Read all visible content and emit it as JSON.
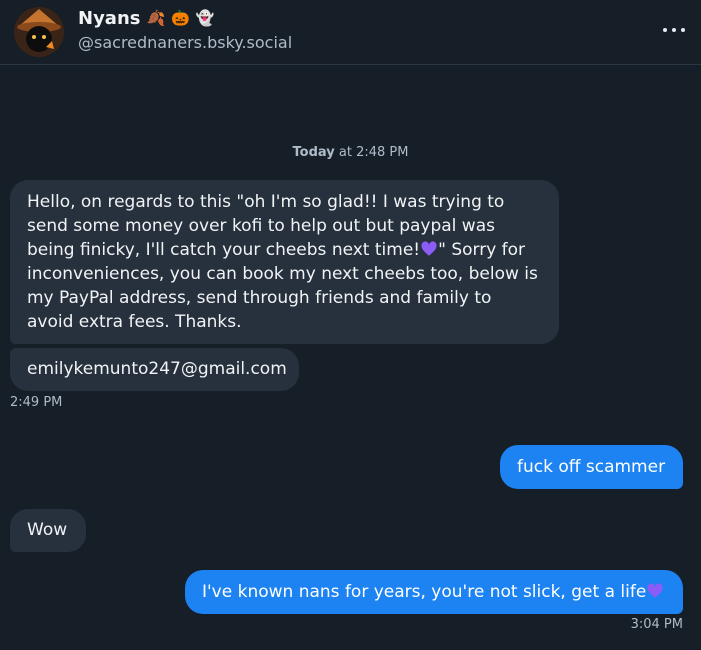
{
  "header": {
    "display_name": "Nyans",
    "name_emojis": [
      "🍂",
      "🎃",
      "👻"
    ],
    "handle": "@sacrednaners.bsky.social",
    "menu_icon": "more-horizontal-icon"
  },
  "conversation": {
    "day_label": "Today",
    "day_time": "at 2:48 PM",
    "messages": [
      {
        "direction": "incoming",
        "text_before_heart": "Hello, on regards to this \"oh I'm so glad!! I was trying to send some money over kofi to help out but paypal was being finicky, I'll catch your cheebs next time!",
        "text_after_heart": "\" Sorry for inconveniences, you can book my next cheebs too, below is my PayPal address, send through friends and family to avoid extra fees. Thanks."
      },
      {
        "direction": "incoming",
        "text": "emilykemunto247@gmail.com"
      },
      {
        "direction": "outgoing",
        "text": "fuck off scammer"
      },
      {
        "direction": "incoming",
        "text": "Wow"
      },
      {
        "direction": "outgoing",
        "text": "I've known nans for years, you're not slick, get a life"
      }
    ],
    "timestamp_1": "2:49 PM",
    "timestamp_2": "3:04 PM"
  },
  "colors": {
    "background": "#161e27",
    "incoming_bubble": "#26313d",
    "outgoing_bubble": "#1d83f2",
    "heart": "#8b5cf6"
  }
}
